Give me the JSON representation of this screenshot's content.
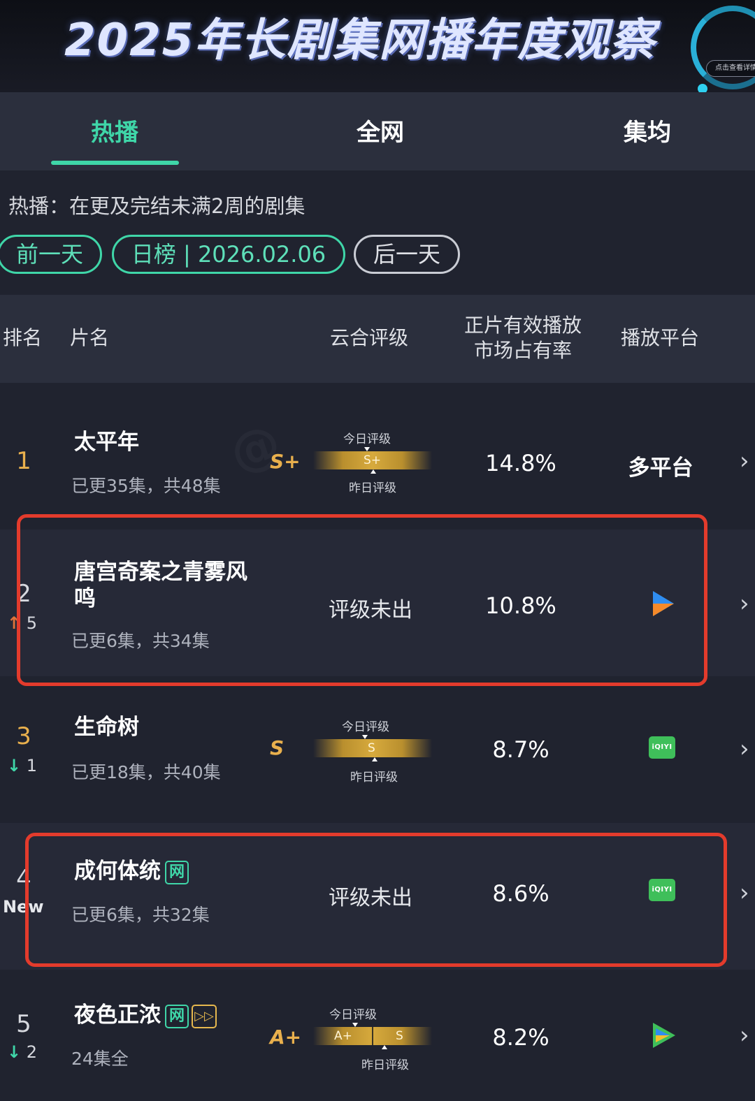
{
  "banner": {
    "title": "2025年长剧集网播年度观察",
    "badge": "点击查看详情"
  },
  "tabs": [
    {
      "label": "热播",
      "active": true
    },
    {
      "label": "全网",
      "active": false
    },
    {
      "label": "集均",
      "active": false
    }
  ],
  "filter": {
    "description": "热播：在更及完结未满2周的剧集",
    "prev_label": "前一天",
    "date_label": "日榜 | 2026.02.06",
    "next_label": "后一天"
  },
  "columns": {
    "rank": "排名",
    "title": "片名",
    "rating": "云合评级",
    "share_line1": "正片有效播放",
    "share_line2": "市场占有率",
    "platform": "播放平台"
  },
  "rating_caption_today": "今日评级",
  "rating_caption_yesterday": "昨日评级",
  "rows": [
    {
      "rank": "1",
      "title": "太平年",
      "episodes": "已更35集，共48集",
      "grade": "S+",
      "bar_left": "S+",
      "bar_right": "",
      "share": "14.8%",
      "platform": "多平台",
      "delta": "",
      "new_tag": ""
    },
    {
      "rank": "2",
      "title": "唐宫奇案之青雾风鸣",
      "episodes": "已更6集，共34集",
      "grade": "",
      "not_out": "评级未出",
      "share": "10.8%",
      "platform": "tencent-video-icon",
      "delta": "5",
      "delta_dir": "up"
    },
    {
      "rank": "3",
      "title": "生命树",
      "episodes": "已更18集，共40集",
      "grade": "S",
      "bar_left": "S",
      "bar_right": "",
      "share": "8.7%",
      "platform": "iqiyi-icon",
      "delta": "1",
      "delta_dir": "down"
    },
    {
      "rank": "4",
      "title": "成何体统",
      "title_tag": "网",
      "episodes": "已更6集，共32集",
      "grade": "",
      "not_out": "评级未出",
      "share": "8.6%",
      "platform": "iqiyi-icon",
      "new_tag": "New"
    },
    {
      "rank": "5",
      "title": "夜色正浓",
      "title_tag": "网",
      "episodes": "24集全",
      "grade": "A+",
      "bar_left": "A+",
      "bar_right": "S",
      "share": "8.2%",
      "platform": "tencent-video-icon",
      "delta": "2",
      "delta_dir": "down"
    }
  ],
  "iqiyi_text": "iQIYI",
  "chevron": "›",
  "colors": {
    "accent": "#3fd6a8",
    "gold": "#e9b04d",
    "highlight": "#e33b2c",
    "background": "#20232f"
  }
}
